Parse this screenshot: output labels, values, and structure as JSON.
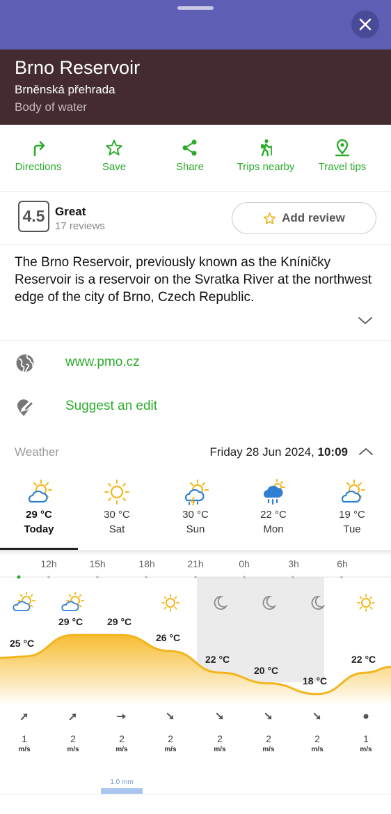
{
  "place": {
    "title": "Brno Reservoir",
    "local_name": "Brněnská přehrada",
    "category": "Body of water"
  },
  "actions": [
    {
      "label": "Directions",
      "icon": "directions-icon"
    },
    {
      "label": "Save",
      "icon": "star-icon"
    },
    {
      "label": "Share",
      "icon": "share-icon"
    },
    {
      "label": "Trips nearby",
      "icon": "hiker-icon"
    },
    {
      "label": "Travel tips",
      "icon": "location-pin-icon"
    }
  ],
  "rating": {
    "score": "4.5",
    "word": "Great",
    "count": "17 reviews",
    "add_review": "Add review"
  },
  "description": "The Brno Reservoir, previously known as the Kníničky Reservoir is a reservoir on the Svratka River at the northwest edge of the city of Brno, Czech Republic.",
  "links": {
    "website": "www.pmo.cz",
    "suggest_edit": "Suggest an edit"
  },
  "weather": {
    "label": "Weather",
    "date": "Friday 28 Jun 2024,",
    "time": "10:09",
    "days": [
      {
        "temp": "29 °C",
        "name": "Today",
        "icon": "partly-cloudy-icon"
      },
      {
        "temp": "30 °C",
        "name": "Sat",
        "icon": "sun-icon"
      },
      {
        "temp": "30 °C",
        "name": "Sun",
        "icon": "thunderstorm-icon"
      },
      {
        "temp": "22 °C",
        "name": "Mon",
        "icon": "rain-icon"
      },
      {
        "temp": "19 °C",
        "name": "Tue",
        "icon": "partly-cloudy-icon"
      }
    ],
    "hour_labels": [
      "12h",
      "15h",
      "18h",
      "21h",
      "0h",
      "3h",
      "6h"
    ],
    "hourly": [
      {
        "temp": "25 °C",
        "icon": "partly-cloudy-icon",
        "wind": "1",
        "unit": "m/s",
        "dir": "ne"
      },
      {
        "temp": "29 °C",
        "icon": "partly-cloudy-icon",
        "wind": "2",
        "unit": "m/s",
        "dir": "ne"
      },
      {
        "temp": "29 °C",
        "icon": "none",
        "wind": "2",
        "unit": "m/s",
        "dir": "e"
      },
      {
        "temp": "26 °C",
        "icon": "sun-icon",
        "wind": "2",
        "unit": "m/s",
        "dir": "se"
      },
      {
        "temp": "22 °C",
        "icon": "moon-icon",
        "wind": "2",
        "unit": "m/s",
        "dir": "se"
      },
      {
        "temp": "20 °C",
        "icon": "moon-icon",
        "wind": "2",
        "unit": "m/s",
        "dir": "se"
      },
      {
        "temp": "18 °C",
        "icon": "moon-icon",
        "wind": "2",
        "unit": "m/s",
        "dir": "se"
      },
      {
        "temp": "22 °C",
        "icon": "sun-icon",
        "wind": "1",
        "unit": "m/s",
        "dir": "calm"
      }
    ],
    "precip_label": "1.0 mm"
  },
  "colors": {
    "topbar": "#5e5fb4",
    "header": "#432b2f",
    "accent_green": "#2bab2b",
    "temp_line": "#f2b51e"
  }
}
